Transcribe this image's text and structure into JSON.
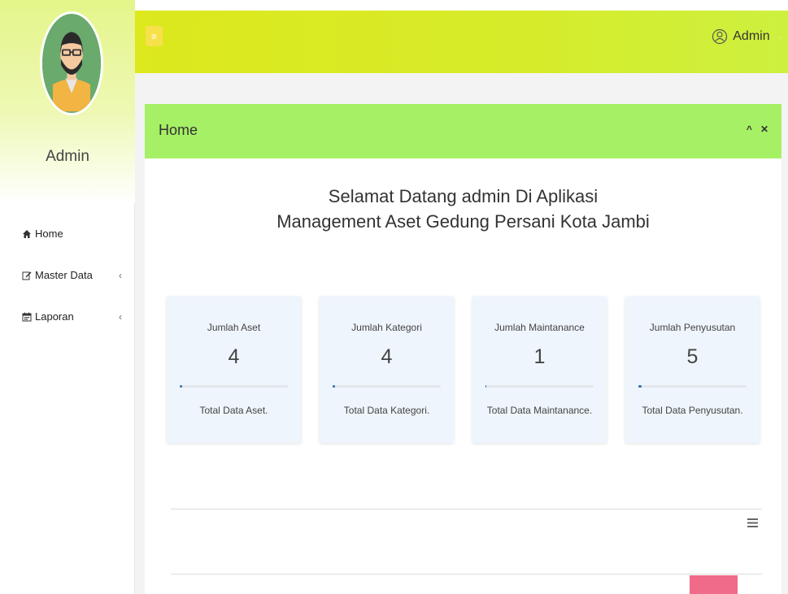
{
  "sidebar": {
    "profile_name": "Admin",
    "avatar_icon": "user-avatar-icon",
    "items": [
      {
        "label": "Home",
        "icon": "home-icon"
      },
      {
        "label": "Master Data",
        "icon": "edit-icon",
        "chevron": "‹"
      },
      {
        "label": "Laporan",
        "icon": "calendar-icon",
        "chevron": "‹"
      }
    ]
  },
  "topbar": {
    "toggle_icon": "menu-toggle-icon",
    "toggle_glyph": "≡",
    "user_label": "Admin",
    "user_icon": "user-outline-icon",
    "caret": "⌄"
  },
  "panel": {
    "title": "Home",
    "collapse_glyph": "^",
    "close_glyph": "✕",
    "welcome_line1": "Selamat Datang admin Di Aplikasi",
    "welcome_line2": "Management Aset Gedung Persani Kota Jambi"
  },
  "cards": [
    {
      "title": "Jumlah Aset",
      "value": "4",
      "footer": "Total Data Aset.",
      "progress": 0.02
    },
    {
      "title": "Jumlah Kategori",
      "value": "4",
      "footer": "Total Data Kategori.",
      "progress": 0.02
    },
    {
      "title": "Jumlah Maintanance",
      "value": "1",
      "footer": "Total Data Maintanance.",
      "progress": 0.01
    },
    {
      "title": "Jumlah Penyusutan",
      "value": "5",
      "footer": "Total Data Penyusutan.",
      "progress": 0.03
    }
  ],
  "colors": {
    "topbar": "#d6ec2a",
    "panel_header": "#a6f065",
    "card_bg": "#eef5fc",
    "progress_fill": "#2f6fb5",
    "accent_pink": "#f06a8a"
  }
}
